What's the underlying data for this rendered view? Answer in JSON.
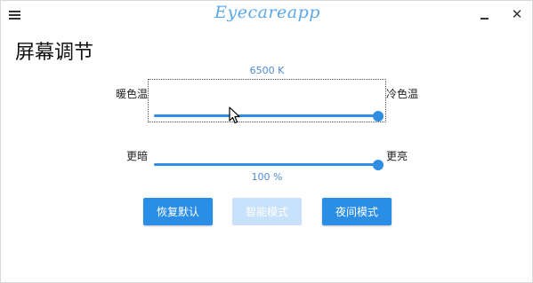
{
  "app": {
    "logo_text": "Eyecareapp"
  },
  "header": {
    "title": "屏幕调节"
  },
  "color_temperature": {
    "value_text": "6500 K",
    "left_label": "暖色温",
    "right_label": "冷色温",
    "level": 1.0
  },
  "brightness": {
    "value_text": "100 %",
    "left_label": "更暗",
    "right_label": "更亮",
    "level": 1.0
  },
  "buttons": {
    "reset_label": "恢复默认",
    "smart_label": "智能模式",
    "night_label": "夜间模式"
  },
  "colors": {
    "accent": "#2b8ee6",
    "disabled": "#c7e2fa",
    "value_text": "#4f8ad6"
  },
  "icons": [
    "hamburger-menu-icon",
    "minimize-icon",
    "close-icon",
    "mouse-pointer-icon"
  ]
}
